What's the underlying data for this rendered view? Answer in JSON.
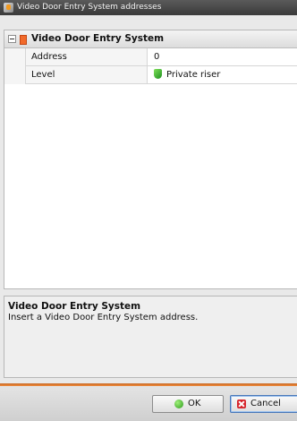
{
  "window": {
    "title": "Video Door Entry System addresses",
    "icon": "app-icon"
  },
  "grid": {
    "group": {
      "title": "Video Door Entry System",
      "icon": "folder-icon",
      "expanded": true
    },
    "rows": [
      {
        "name": "Address",
        "value": "0"
      },
      {
        "name": "Level",
        "value": "Private riser",
        "icon": "green-shield-icon"
      }
    ]
  },
  "description": {
    "title": "Video Door Entry System",
    "text": "Insert a Video Door Entry System address."
  },
  "buttons": {
    "ok": "OK",
    "cancel": "Cancel"
  },
  "colors": {
    "accent": "#f08a3a",
    "titlebar": "#4a4a4a",
    "focus": "#4a78b8"
  }
}
